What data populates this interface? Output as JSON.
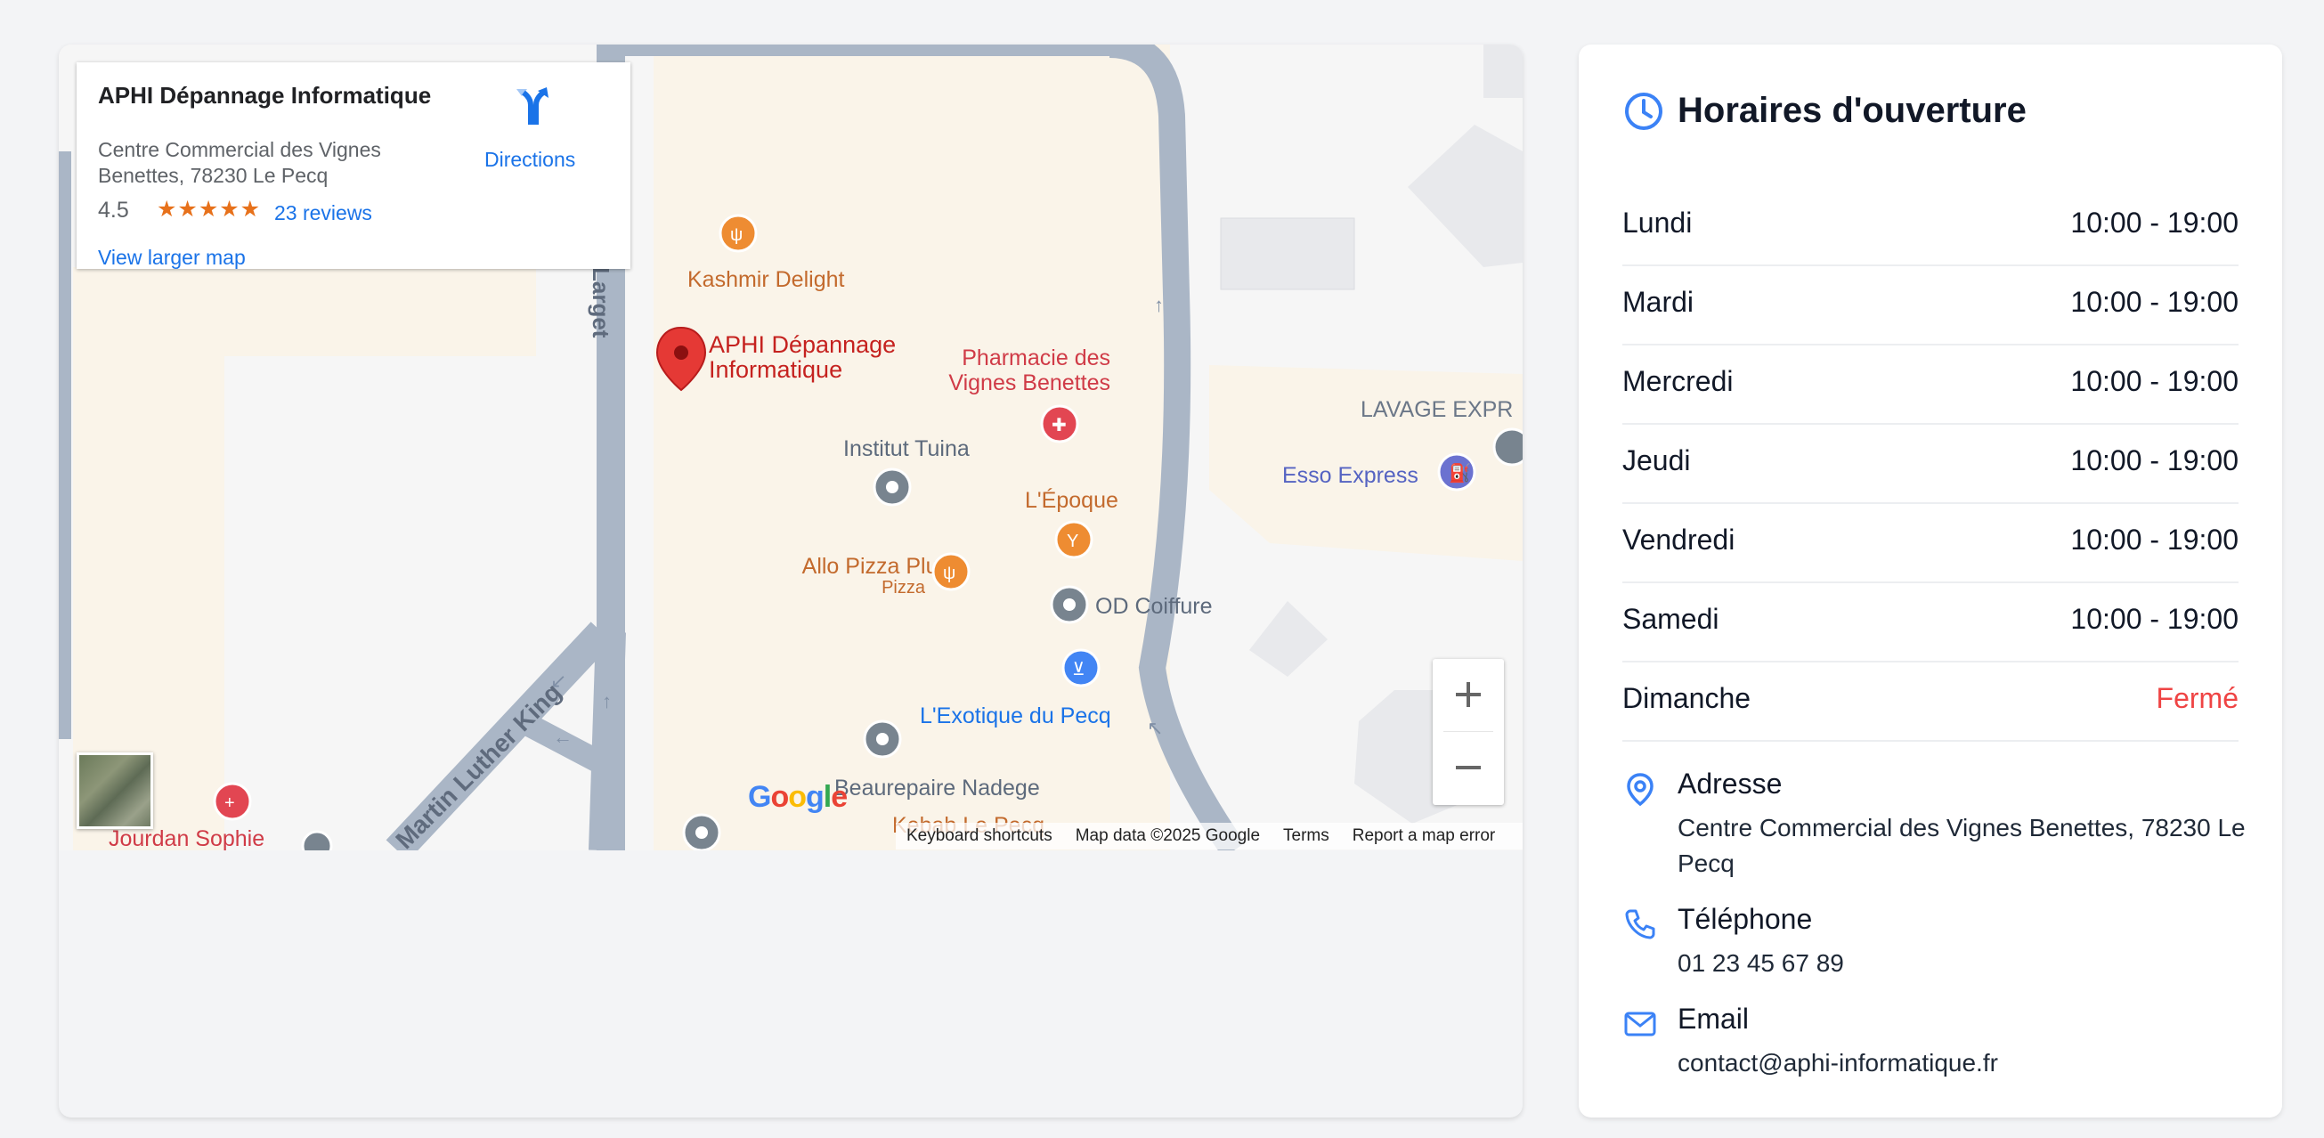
{
  "map": {
    "place_name": "APHI Dépannage Informatique",
    "place_address": "Centre Commercial des Vignes Benettes, 78230 Le Pecq",
    "rating": "4.5",
    "stars": "★★★★★",
    "reviews": "23 reviews",
    "directions": "Directions",
    "view_larger": "View larger map",
    "zoom_in": "+",
    "zoom_out": "−",
    "google": "Google",
    "attribution": {
      "shortcuts": "Keyboard shortcuts",
      "map_data": "Map data ©2025 Google",
      "terms": "Terms",
      "report": "Report a map error"
    },
    "pois": {
      "kashmir": "Kashmir Delight",
      "aphi_1": "APHI Dépannage",
      "aphi_2": "Informatique",
      "pharmacie_1": "Pharmacie des",
      "pharmacie_2": "Vignes Benettes",
      "institut": "Institut Tuina",
      "epoque": "L'Époque",
      "allo_pizza": "Allo Pizza Plus",
      "pizza": "Pizza",
      "od_coiffure": "OD Coiffure",
      "exotique": "L'Exotique du Pecq",
      "beaurepaire": "Beaurepaire Nadege",
      "kebab": "Kebab Le Pecq",
      "jourdan": "Jourdan Sophie",
      "esso": "Esso Express",
      "lavage": "LAVAGE EXPR",
      "larget": "Larget",
      "mlk": "Martin Luther King"
    }
  },
  "hours": {
    "title": "Horaires d'ouverture",
    "days": [
      {
        "day": "Lundi",
        "time": "10:00 - 19:00"
      },
      {
        "day": "Mardi",
        "time": "10:00 - 19:00"
      },
      {
        "day": "Mercredi",
        "time": "10:00 - 19:00"
      },
      {
        "day": "Jeudi",
        "time": "10:00 - 19:00"
      },
      {
        "day": "Vendredi",
        "time": "10:00 - 19:00"
      },
      {
        "day": "Samedi",
        "time": "10:00 - 19:00"
      },
      {
        "day": "Dimanche",
        "time": "Fermé"
      }
    ]
  },
  "contact": {
    "address_label": "Adresse",
    "address_value": "Centre Commercial des Vignes Benettes, 78230 Le Pecq",
    "phone_label": "Téléphone",
    "phone_value": "01 23 45 67 89",
    "email_label": "Email",
    "email_value": "contact@aphi-informatique.fr"
  },
  "colors": {
    "accent": "#3b82f6",
    "closed": "#ef4444",
    "link": "#1a73e8"
  }
}
